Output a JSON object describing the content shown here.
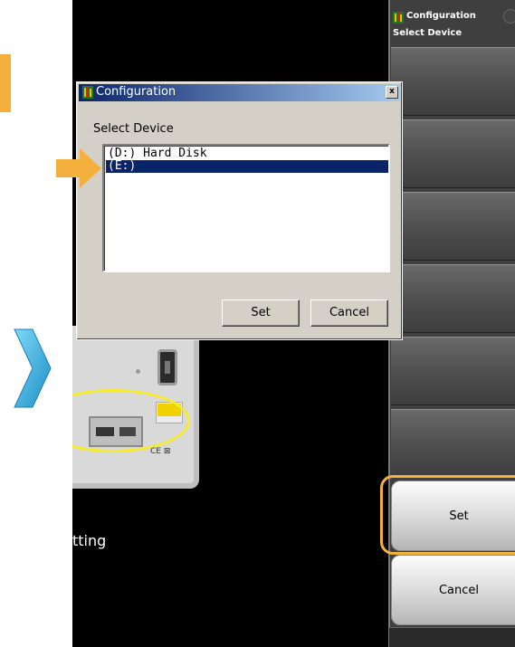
{
  "background_setting_text": "tting",
  "side_panel": {
    "header_title": "Configuration",
    "header_subtitle": "Select Device",
    "set_button_label": "Set",
    "cancel_button_label": "Cancel"
  },
  "dialog": {
    "title": "Configuration",
    "close_glyph": "x",
    "label": "Select Device",
    "devices": [
      "(D:) Hard Disk",
      "(E:)"
    ],
    "selected_device": "(E:)",
    "set_label": "Set",
    "cancel_label": "Cancel"
  },
  "colors": {
    "highlight_orange": "#f4b03c",
    "selection_blue": "#0a246a",
    "callout_cyan": "#29b6e8"
  },
  "icons": [
    "config-icon",
    "close-icon",
    "pointer-arrow-icon",
    "next-step-arrow-icon"
  ]
}
